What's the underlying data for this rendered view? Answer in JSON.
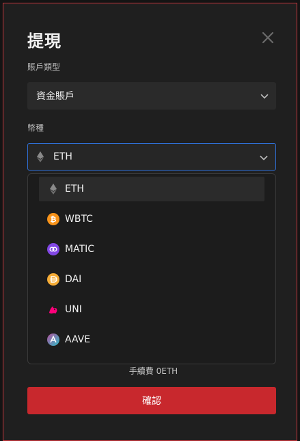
{
  "modal": {
    "title": "提現",
    "account_type_label": "賬戶類型",
    "account_type_value": "資金賬戶",
    "currency_label": "幣種",
    "currency_value": "ETH",
    "fee_text": "手續費 0ETH",
    "confirm_label": "確認"
  },
  "dropdown": {
    "options": [
      {
        "label": "ETH",
        "icon": "eth-icon"
      },
      {
        "label": "WBTC",
        "icon": "wbtc-icon"
      },
      {
        "label": "MATIC",
        "icon": "matic-icon"
      },
      {
        "label": "DAI",
        "icon": "dai-icon"
      },
      {
        "label": "UNI",
        "icon": "uni-icon"
      },
      {
        "label": "AAVE",
        "icon": "aave-icon"
      }
    ],
    "selected": "ETH"
  },
  "colors": {
    "accent_red": "#c8282d",
    "focus_blue": "#2f6fd6"
  }
}
